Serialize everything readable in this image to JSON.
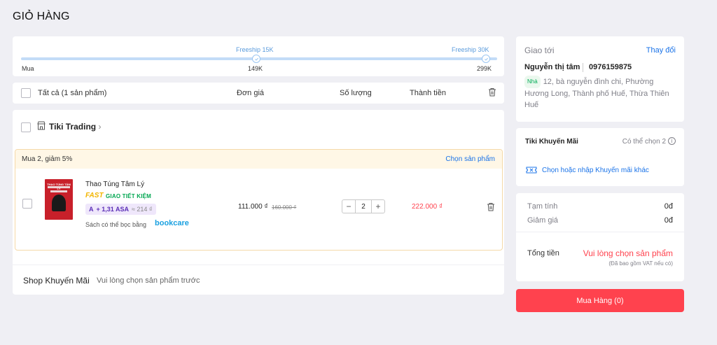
{
  "page": {
    "title": "GIỎ HÀNG"
  },
  "freeship": {
    "progress_fraction": 0.0,
    "milestones": [
      {
        "label": "Freeship 15K",
        "value": "149K"
      },
      {
        "label": "Freeship 30K",
        "value": "299K"
      }
    ],
    "start_label": "Mua"
  },
  "header": {
    "select_all_label": "Tất cả (1 sản phẩm)",
    "unit_price_label": "Đơn giá",
    "quantity_label": "Số lượng",
    "total_label": "Thành tiền",
    "delete_icon": "trash-icon"
  },
  "seller": {
    "icon": "store-icon",
    "name": "Tiki Trading",
    "promo_text": "Mua 2, giảm 5%",
    "promo_link": "Chọn sản phẩm",
    "product": {
      "cover_title": "THAO TÚNG TÂM LÝ",
      "name": "Thao Túng Tâm Lý",
      "fast_label": "FAST",
      "fast_sub": "GIAO TIẾT KIỆM",
      "asa_prefix": "+ 1,31 ASA",
      "asa_approx": "≈ 214 ₫",
      "wrap_note": "Sách có thể bọc bằng",
      "wrap_brand": "bookcare",
      "unit_price": "111.000 ₫",
      "old_price": "160.000 ₫",
      "quantity": "2",
      "minus": "−",
      "plus": "+",
      "total_price": "222.000 ₫"
    },
    "shop_promo_label": "Shop Khuyến Mãi",
    "shop_promo_text": "Vui lòng chọn sản phẩm trước"
  },
  "address": {
    "title": "Giao tới",
    "change_label": "Thay đổi",
    "name": "Nguyễn thị tâm",
    "phone": "0976159875",
    "badge": "Nhà",
    "address_text": "12, bà nguyễn đình chi, Phường Hương Long, Thành phố Huế, Thừa Thiên Huế"
  },
  "coupon": {
    "title": "Tiki Khuyến Mãi",
    "choose_label": "Có thể chọn 2",
    "link_label": "Chọn hoặc nhập Khuyến mãi khác"
  },
  "summary": {
    "subtotal_label": "Tạm tính",
    "subtotal_value": "0đ",
    "discount_label": "Giảm giá",
    "discount_value": "0đ",
    "total_label": "Tổng tiền",
    "total_message": "Vui lòng chọn sản phẩm",
    "vat_note": "(Đã bao gồm VAT nếu có)"
  },
  "buy_button": {
    "label": "Mua Hàng (0)"
  },
  "colors": {
    "accent_red": "#ff424e",
    "link_blue": "#1a73e8",
    "promo_bg": "#fff7e6"
  }
}
